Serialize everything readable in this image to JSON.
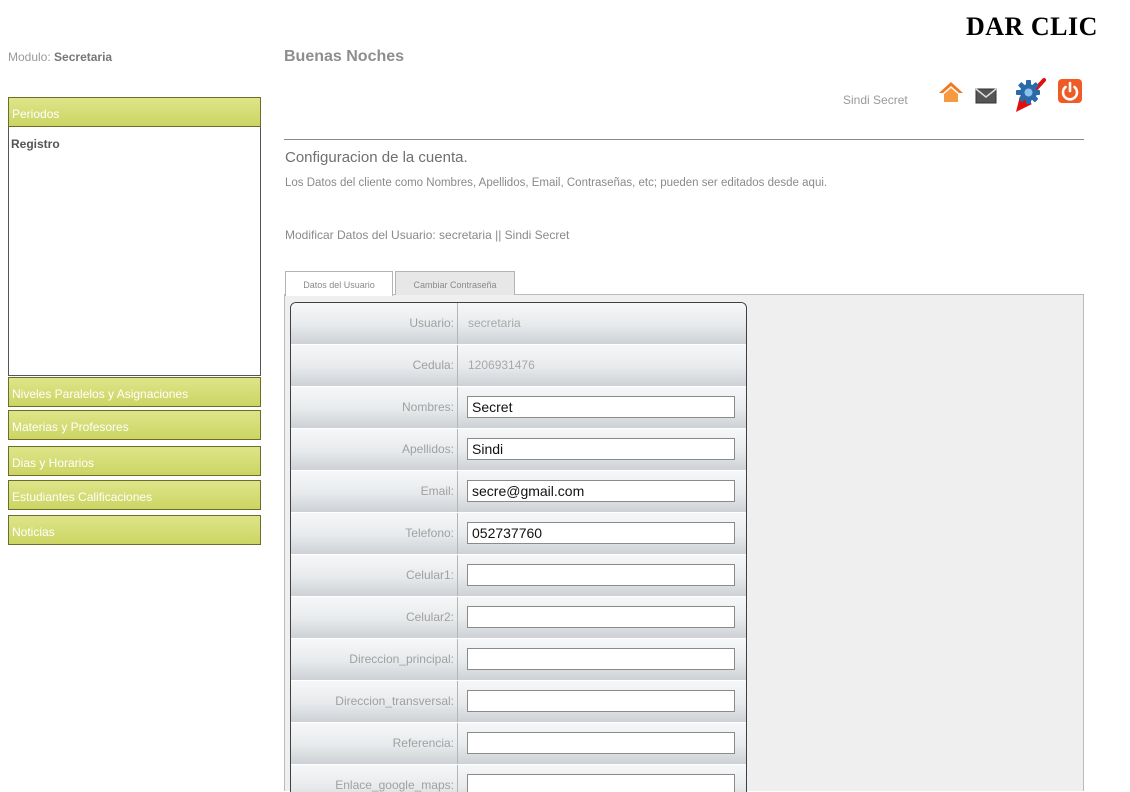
{
  "annotation": {
    "text": "DAR CLIC"
  },
  "header": {
    "modulo_label": "Modulo:",
    "modulo_value": "Secretaria",
    "greeting": "Buenas Noches",
    "user_name": "Sindi Secret",
    "icons": [
      "home-icon",
      "mail-icon",
      "gear-icon",
      "power-icon"
    ]
  },
  "sidebar": {
    "items": [
      {
        "label": "Periodos"
      },
      {
        "label": "Registro"
      },
      {
        "label": "Niveles Paralelos y Asignaciones"
      },
      {
        "label": "Materias y Profesores"
      },
      {
        "label": "Dias y Horarios"
      },
      {
        "label": "Estudiantes Calificaciones"
      },
      {
        "label": "Noticias"
      }
    ]
  },
  "content": {
    "title": "Configuracion de la cuenta.",
    "description": "Los Datos del cliente como Nombres, Apellidos, Email, Contraseñas, etc; pueden ser editados desde aqui.",
    "modify_line": "Modificar Datos del Usuario: secretaria || Sindi Secret",
    "tabs": [
      {
        "label": "Datos del Usuario"
      },
      {
        "label": "Cambiar Contraseña"
      }
    ],
    "fields": [
      {
        "label": "Usuario:",
        "value": "secretaria"
      },
      {
        "label": "Cedula:",
        "value": "1206931476"
      },
      {
        "label": "Nombres:",
        "value": "Secret"
      },
      {
        "label": "Apellidos:",
        "value": "Sindi"
      },
      {
        "label": "Email:",
        "value": "secre@gmail.com"
      },
      {
        "label": "Telefono:",
        "value": "052737760"
      },
      {
        "label": "Celular1:",
        "value": ""
      },
      {
        "label": "Celular2:",
        "value": ""
      },
      {
        "label": "Direccion_principal:",
        "value": ""
      },
      {
        "label": "Direccion_transversal:",
        "value": ""
      },
      {
        "label": "Referencia:",
        "value": ""
      },
      {
        "label": "Enlace_google_maps:",
        "value": ""
      }
    ]
  },
  "colors": {
    "sidebar_accent": "#d4dc72",
    "arrow": "#e01010",
    "home_icon": "#f07a20",
    "power_icon": "#f05a24",
    "gear_icon": "#2a6aa8"
  }
}
